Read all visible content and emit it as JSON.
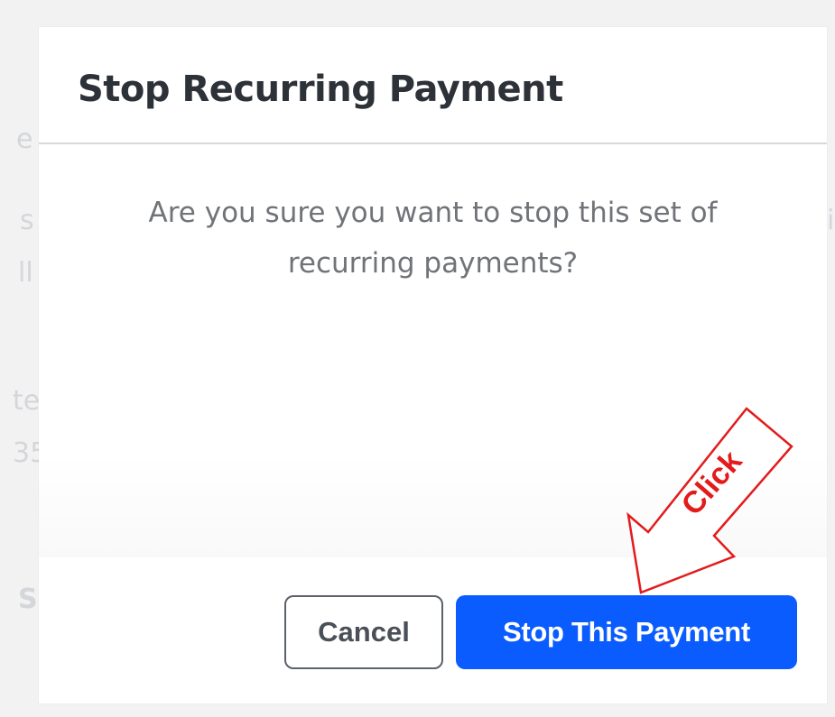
{
  "background": {
    "fragments": [
      "e",
      "s",
      "ll",
      "te",
      "35",
      "S",
      "i"
    ]
  },
  "dialog": {
    "title": "Stop Recurring Payment",
    "message": "Are you sure you want to stop this set of recurring payments?",
    "cancel_label": "Cancel",
    "confirm_label": "Stop This Payment"
  },
  "annotation": {
    "label": "Click",
    "icon": "arrow-callout-icon"
  },
  "colors": {
    "primary": "#0b5cff",
    "annotation": "#e31b1b",
    "title": "#2d3138",
    "message": "#707378"
  }
}
